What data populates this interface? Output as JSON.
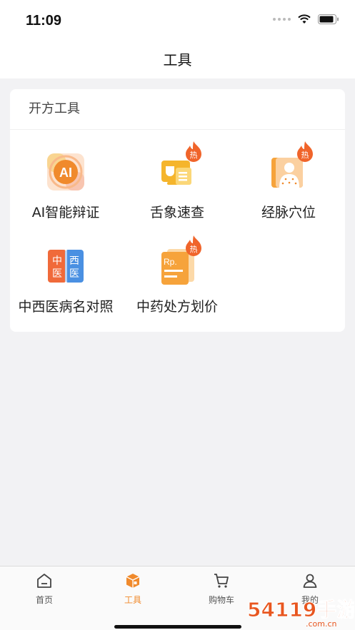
{
  "status": {
    "time": "11:09"
  },
  "nav": {
    "title": "工具"
  },
  "card": {
    "title": "开方工具",
    "tools": [
      {
        "label": "AI智能辩证",
        "icon": "ai-icon",
        "hot": false
      },
      {
        "label": "舌象速查",
        "icon": "tongue-icon",
        "hot": true,
        "hot_text": "热"
      },
      {
        "label": "经脉穴位",
        "icon": "acupoint-icon",
        "hot": true,
        "hot_text": "热"
      },
      {
        "label": "中西医病名对照",
        "icon": "zhongxi-icon",
        "hot": false,
        "icon_text": [
          "中",
          "医",
          "西",
          "医"
        ]
      },
      {
        "label": "中药处方划价",
        "icon": "prescription-icon",
        "hot": true,
        "hot_text": "热",
        "icon_text": "Rp."
      }
    ],
    "ai_icon_text": "AI"
  },
  "tabbar": {
    "tabs": [
      {
        "label": "首页",
        "icon": "home-icon",
        "active": false
      },
      {
        "label": "工具",
        "icon": "toolbox-icon",
        "active": true
      },
      {
        "label": "购物车",
        "icon": "cart-icon",
        "active": false
      },
      {
        "label": "我的",
        "icon": "profile-icon",
        "active": false
      }
    ]
  },
  "watermark": {
    "text": "54119手游网",
    "subtext": ".com.cn"
  },
  "colors": {
    "accent": "#f08a2c",
    "hot": "#f0642a",
    "background": "#f2f2f4"
  }
}
